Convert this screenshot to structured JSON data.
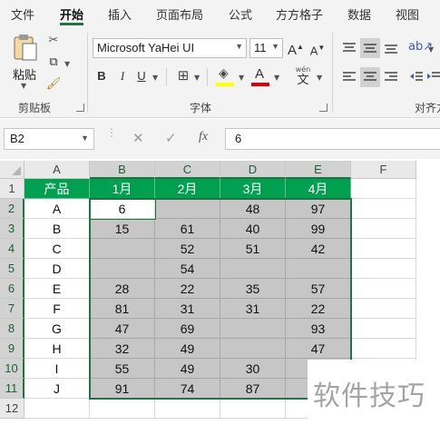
{
  "tabs": [
    {
      "label": "文件",
      "active": false
    },
    {
      "label": "开始",
      "active": true
    },
    {
      "label": "插入",
      "active": false
    },
    {
      "label": "页面布局",
      "active": false
    },
    {
      "label": "公式",
      "active": false
    },
    {
      "label": "方方格子",
      "active": false
    },
    {
      "label": "数据",
      "active": false
    },
    {
      "label": "视图",
      "active": false
    }
  ],
  "ribbon": {
    "clipboard": {
      "paste_label": "粘贴",
      "group_label": "剪贴板"
    },
    "font": {
      "font_name": "Microsoft YaHei UI",
      "font_size": "11",
      "group_label": "字体",
      "bold": "B",
      "italic": "I",
      "underline": "U",
      "grow_font": "A",
      "shrink_font": "A",
      "font_color_glyph": "A",
      "phonetic_glyph": "wén",
      "phonetic_sub": "文",
      "highlight_color": "#ffff00",
      "font_color": "#e00000"
    },
    "alignment": {
      "group_label": "对齐方"
    }
  },
  "formula_bar": {
    "name_box": "B2",
    "fx": "fx",
    "formula": "6",
    "cancel_glyph": "✕",
    "enter_glyph": "✓"
  },
  "sheet": {
    "columns": [
      "A",
      "B",
      "C",
      "D",
      "E",
      "F"
    ],
    "rows": [
      "1",
      "2",
      "3",
      "4",
      "5",
      "6",
      "7",
      "8",
      "9",
      "10",
      "11",
      "12"
    ],
    "header_row": [
      "产品",
      "1月",
      "2月",
      "3月",
      "4月"
    ],
    "data": [
      [
        "A",
        "6",
        "",
        "48",
        "97"
      ],
      [
        "B",
        "15",
        "61",
        "40",
        "99"
      ],
      [
        "C",
        "",
        "52",
        "51",
        "42"
      ],
      [
        "D",
        "",
        "54",
        "",
        ""
      ],
      [
        "E",
        "28",
        "22",
        "35",
        "57"
      ],
      [
        "F",
        "81",
        "31",
        "31",
        "22"
      ],
      [
        "G",
        "47",
        "69",
        "",
        "93"
      ],
      [
        "H",
        "32",
        "49",
        "",
        "47"
      ],
      [
        "I",
        "55",
        "49",
        "30",
        ""
      ],
      [
        "J",
        "91",
        "74",
        "87",
        ""
      ]
    ],
    "header_fill": "#00a050",
    "selection_fill": "#c6c6c6",
    "selection_border": "#217346"
  },
  "watermark": "软件技巧"
}
